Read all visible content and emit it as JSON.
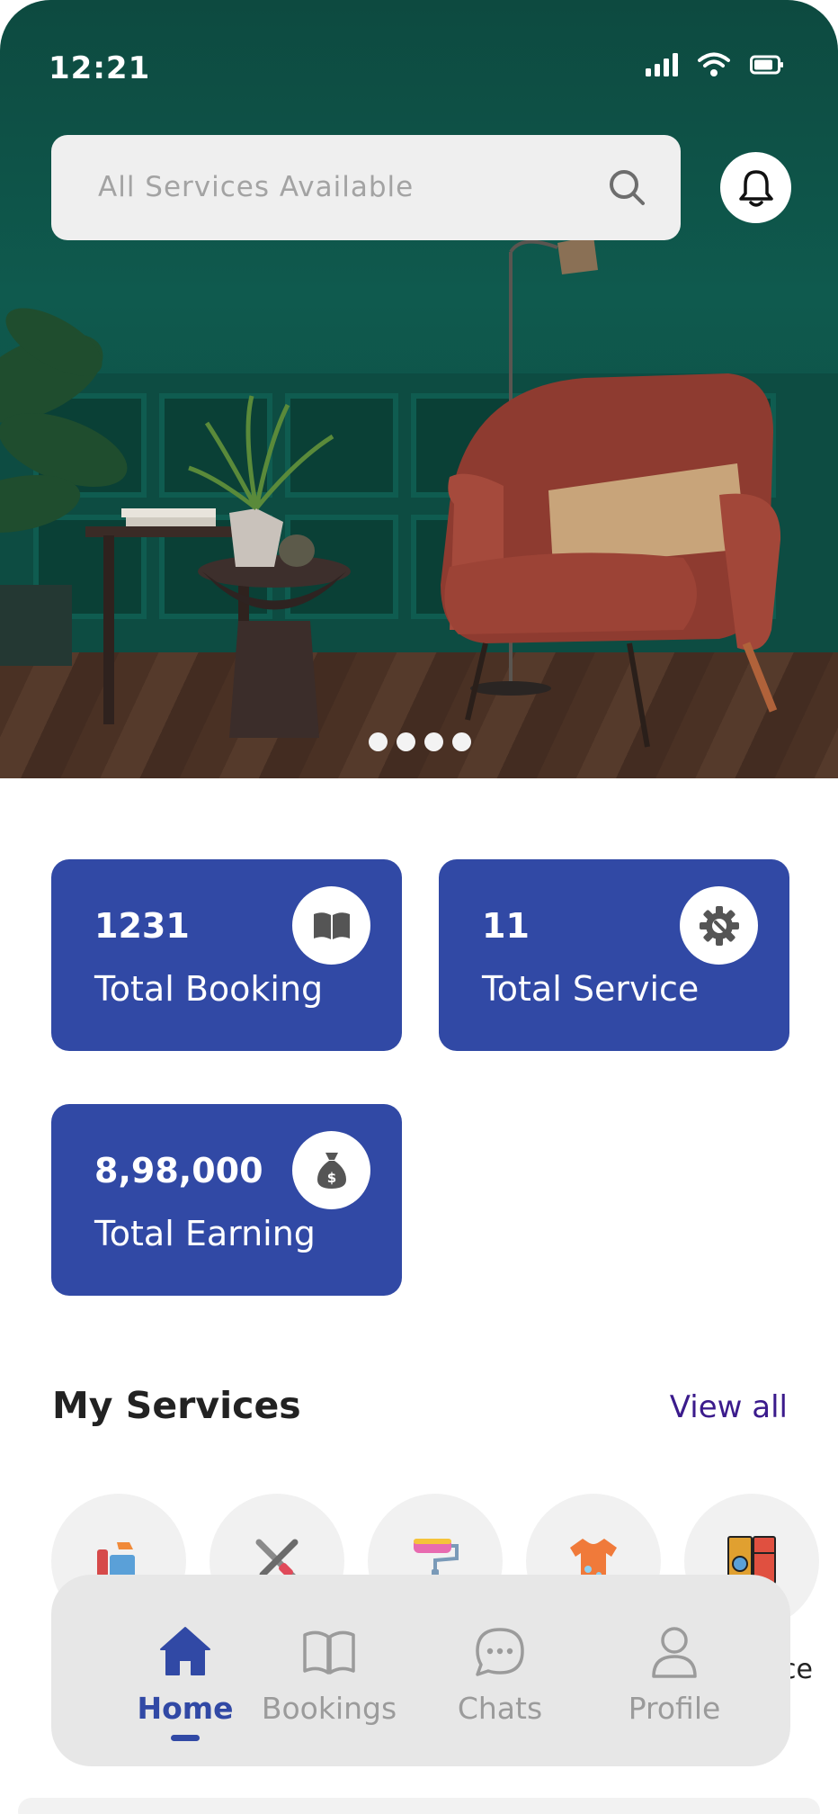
{
  "status_bar": {
    "time": "12:21"
  },
  "search": {
    "placeholder": "All Services Available"
  },
  "hero": {
    "slides_count": 4,
    "active_slide": 1
  },
  "stats": [
    {
      "value": "1231",
      "label": "Total Booking",
      "icon": "book-icon"
    },
    {
      "value": "11",
      "label": "Total Service",
      "icon": "gear-icon"
    },
    {
      "value": "8,98,000",
      "label": "Total Earning",
      "icon": "money-bag-icon"
    }
  ],
  "services": {
    "title": "My Services",
    "view_all": "View all",
    "partial_label": "nce",
    "items": [
      {
        "icon": "cleaning-supplies-icon"
      },
      {
        "icon": "tools-icon"
      },
      {
        "icon": "paint-roller-icon"
      },
      {
        "icon": "laundry-shirt-icon"
      },
      {
        "icon": "appliance-icon"
      }
    ]
  },
  "nav": {
    "items": [
      {
        "label": "Home",
        "icon": "home-icon",
        "active": true
      },
      {
        "label": "Bookings",
        "icon": "book-icon",
        "active": false
      },
      {
        "label": "Chats",
        "icon": "chat-icon",
        "active": false
      },
      {
        "label": "Profile",
        "icon": "profile-icon",
        "active": false
      }
    ]
  },
  "colors": {
    "primary": "#3149a5",
    "hero_green": "#0f5a4e",
    "link": "#3b1b8c"
  }
}
